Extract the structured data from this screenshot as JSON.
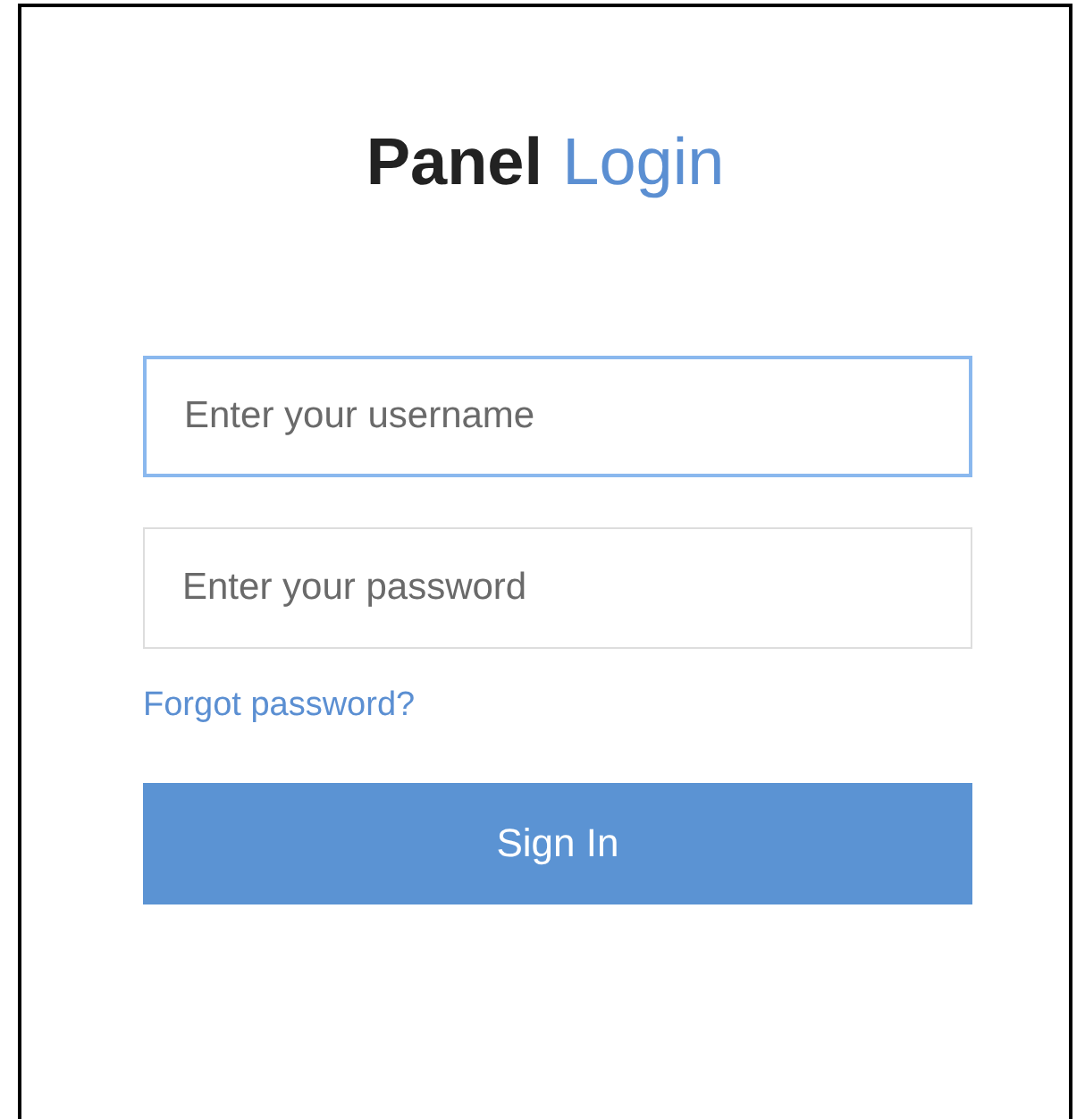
{
  "title": {
    "brand": "Panel",
    "page": "Login"
  },
  "fields": [
    {
      "placeholder": "Enter your username",
      "focused": true
    },
    {
      "placeholder": "Enter your password",
      "focused": false
    }
  ],
  "forgot_link": "Forgot password?",
  "submit": "Sign In"
}
